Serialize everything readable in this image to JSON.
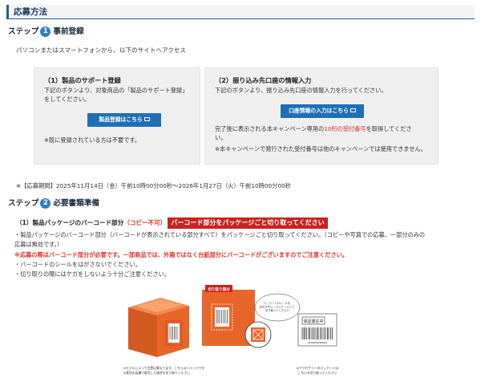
{
  "section_title": "応募方法",
  "step1": {
    "label": "ステップ",
    "num": "1",
    "title": "事前登録",
    "intro": "パソコンまたはスマートフォンから、以下のサイトへアクセス"
  },
  "box1": {
    "title": "（1）製品のサポート登録",
    "desc_line1": "下記のボタンより、対象商品の「製品のサポート登録」",
    "desc_line2": "をしてください。",
    "button": "製品登録はこちら",
    "note": "※既に登録されている方は不要です。"
  },
  "box2": {
    "title": "（2）振り込み先口座の情報入力",
    "desc": "下記のボタンより、振り込み先口座の情報入力を行ってください。",
    "button": "口座情報の入力はこちら",
    "after_prefix": "完了後に表示される本キャンペーン専用の",
    "after_red": "10桁の受付番号",
    "after_suffix": "を取得してくださ",
    "after_line2": "い。",
    "note": "※本キャンペーンで発行された受付番号は他のキャンペーンでは使用できません。"
  },
  "period": "※【応募期間】2025年11月14日（金）午前10時00分00秒〜2026年1月27日（火）午前10時00分00秒",
  "step2": {
    "label": "ステップ",
    "num": "2",
    "title": "必要書類準備"
  },
  "package": {
    "heading": "（1）製品パッケージのバーコード部分",
    "warn": "（コピー不可）",
    "banner": "バーコード部分をパッケージごと切り取ってください",
    "line1": "・製品パッケージのバーコード部分（バーコードが表示されている部分すべて）をパッケージごと切り取ってください。（コピーや写真での応募、一部分のみの",
    "line1b": "応募は無効です。）",
    "line2": "※応募の際はバーコード部分が必要です。一部商品では、外箱ではなく台紙部分にバーコードがございますのでご注意ください。",
    "line3": "・バーコードのシールをはがさないでください。",
    "line4": "・切り取りの際にはケガをしないよう十分ご注意ください。"
  },
  "illustration": {
    "cut_label": "切り取り部分",
    "bubble_text": "バーコードのシールをはがさずに、パッケージごと切り取ってください",
    "caption1": "※モデルによって位置は異なります。こちらはイメージです",
    "caption2": "※実在の店舗で販売した場合を切り取りください",
    "warranty_label": "保証書在中",
    "barcode_digits": "0000000000000",
    "caption3a": "※アクセサリーのパッケージは",
    "caption3b": "こちらを切り取ってください"
  },
  "colors": {
    "accent_blue": "#1e6fb6",
    "warning_red": "#e0322b",
    "box_orange": "#e8652a"
  }
}
